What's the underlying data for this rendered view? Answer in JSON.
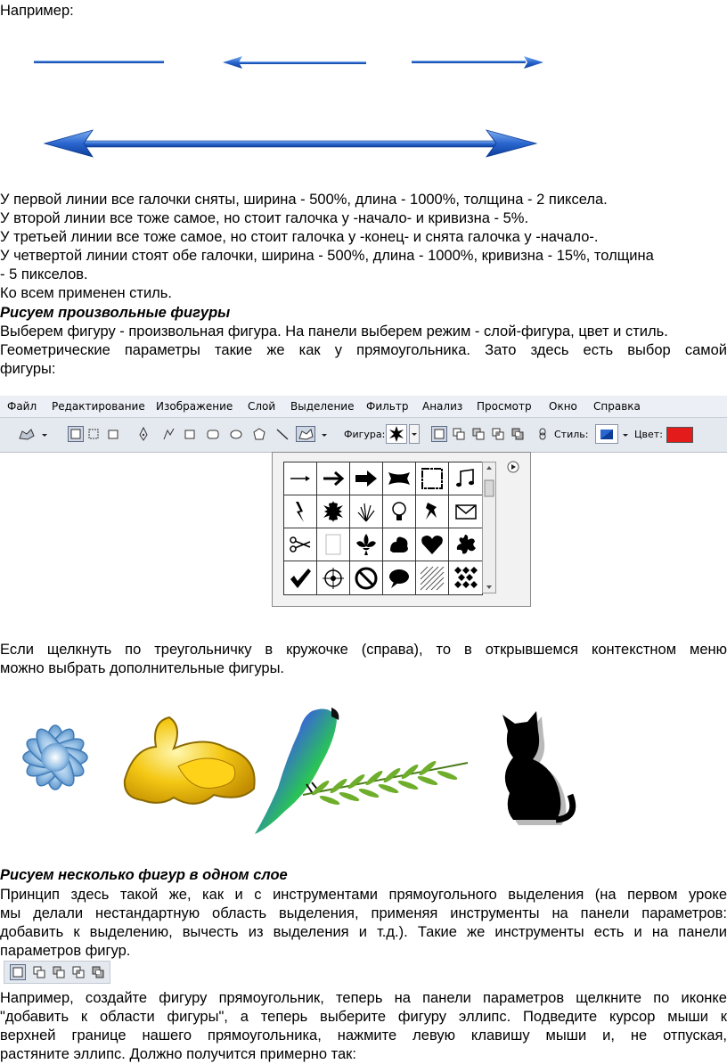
{
  "intro": "Например:",
  "paragraph1": [
    "У первой линии все галочки сняты, ширина - 500%, длина - 1000%, толщина - 2 пиксела.",
    "У второй линии все тоже самое, но стоит галочка у -начало- и кривизна - 5%.",
    "У третьей линии все тоже самое, но стоит галочка у -конец- и снята галочка у -начало-.",
    "У четвертой линии стоят обе галочки, ширина - 500%, длина - 1000%, кривизна - 15%, толщина",
    "- 5 пикселов.",
    "Ко всем применен стиль."
  ],
  "heading1": "Рисуем произвольные фигуры",
  "paragraph2": [
    "Выберем фигуру - произвольная фигура. На панели выберем режим - слой-фигура, цвет и стиль.",
    "Геометрические параметры такие же как у прямоугольника. Зато здесь есть выбор самой",
    "фигуры:"
  ],
  "menu": [
    "Файл",
    "Редактирование",
    "Изображение",
    "Слой",
    "Выделение",
    "Фильтр",
    "Анализ",
    "Просмотр",
    "Окно",
    "Справка"
  ],
  "options_bar": {
    "shape_label": "Фигура:",
    "style_label": "Стиль:",
    "color_label": "Цвет:",
    "color_value": "#e31b1b"
  },
  "shape_icons": [
    "arrow-thin-icon",
    "arrow-icon",
    "arrow-bold-icon",
    "banner-icon",
    "frame-icon",
    "music-note-icon",
    "lightning-icon",
    "starburst-icon",
    "grass-icon",
    "lightbulb-icon",
    "pushpin-icon",
    "envelope-icon",
    "scissors-icon",
    "blank-paper-icon",
    "fleur-de-lis-icon",
    "puzzle-bird-icon",
    "heart-icon",
    "splat-icon",
    "checkmark-icon",
    "target-icon",
    "no-sign-icon",
    "speech-bubble-icon",
    "hatch-pattern-icon",
    "checker-pattern-icon"
  ],
  "paragraph3": [
    "Если щелкнуть по треугольничку в кружочке (справа), то в открывшемся контекстном меню",
    "можно выбрать дополнительные фигуры."
  ],
  "heading2": "Рисуем несколько фигур в одном слое",
  "paragraph4": [
    "Принцип здесь такой же, как и с инструментами прямоугольного выделения (на первом уроке",
    "мы делали нестандартную область выделения, применяя инструменты на панели параметров:",
    "добавить к выделению, вычесть из выделения и т.д.). Такие же инструменты есть и на панели",
    "параметров фигур."
  ],
  "paragraph5": [
    "Например, создайте фигуру прямоугольник, теперь на панели параметров щелкните по иконке",
    "\"добавить к области фигуры\", а теперь выберите фигуру эллипс. Подведите курсор мыши к",
    "верхней границе нашего прямоугольника, нажмите левую клавишу мыши и, не отпуская,",
    "растяните эллипс. Должно получится примерно так:"
  ]
}
